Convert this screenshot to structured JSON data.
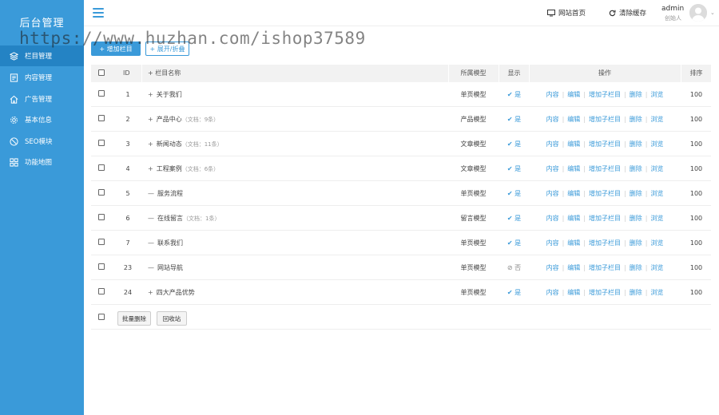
{
  "sidebar": {
    "brand": "后台管理",
    "items": [
      {
        "label": "栏目管理",
        "icon": "layers-icon"
      },
      {
        "label": "内容管理",
        "icon": "document-icon"
      },
      {
        "label": "广告管理",
        "icon": "home-icon"
      },
      {
        "label": "基本信息",
        "icon": "gear-icon"
      },
      {
        "label": "SEO模块",
        "icon": "compass-icon"
      },
      {
        "label": "功能地图",
        "icon": "grid-icon"
      }
    ]
  },
  "header": {
    "site_home": "网站首页",
    "clear_cache": "清除缓存",
    "admin_name": "admin",
    "admin_role": "创始人"
  },
  "watermark": "https://www.huzhan.com/ishop37589",
  "toolbar": {
    "add_label": "+ 增加栏目",
    "expand_label": "+ 展开/折叠"
  },
  "table": {
    "headers": {
      "id": "ID",
      "name": "+ 栏目名称",
      "model": "所属模型",
      "show": "显示",
      "ops": "操作",
      "sort": "排序"
    },
    "ops_labels": [
      "内容",
      "编辑",
      "增加子栏目",
      "删除",
      "浏览"
    ],
    "rows": [
      {
        "id": "1",
        "mark": "+",
        "name": "关于我们",
        "count": "",
        "model": "单页模型",
        "show": "是",
        "visible": true,
        "sort": "100"
      },
      {
        "id": "2",
        "mark": "+",
        "name": "产品中心",
        "count": "（文档：9条）",
        "model": "产品模型",
        "show": "是",
        "visible": true,
        "sort": "100"
      },
      {
        "id": "3",
        "mark": "+",
        "name": "新闻动态",
        "count": "（文档：11条）",
        "model": "文章模型",
        "show": "是",
        "visible": true,
        "sort": "100"
      },
      {
        "id": "4",
        "mark": "+",
        "name": "工程案例",
        "count": "（文档：6条）",
        "model": "文章模型",
        "show": "是",
        "visible": true,
        "sort": "100"
      },
      {
        "id": "5",
        "mark": "—",
        "name": "服务流程",
        "count": "",
        "model": "单页模型",
        "show": "是",
        "visible": true,
        "sort": "100"
      },
      {
        "id": "6",
        "mark": "—",
        "name": "在线留言",
        "count": "（文档：1条）",
        "model": "留言模型",
        "show": "是",
        "visible": true,
        "sort": "100"
      },
      {
        "id": "7",
        "mark": "—",
        "name": "联系我们",
        "count": "",
        "model": "单页模型",
        "show": "是",
        "visible": true,
        "sort": "100"
      },
      {
        "id": "23",
        "mark": "—",
        "name": "网站导航",
        "count": "",
        "model": "单页模型",
        "show": "否",
        "visible": false,
        "sort": "100"
      },
      {
        "id": "24",
        "mark": "+",
        "name": "四大产品优势",
        "count": "",
        "model": "单页模型",
        "show": "是",
        "visible": true,
        "sort": "100"
      }
    ]
  },
  "footer": {
    "batch_delete": "批量删除",
    "recycle_bin": "回收站"
  },
  "colors": {
    "primary": "#3a9ad9",
    "sidebar_active": "#2483c4"
  }
}
